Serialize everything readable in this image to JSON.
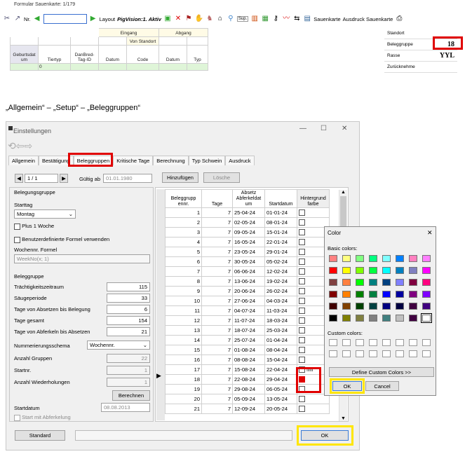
{
  "toolbar": {
    "title": "Formular Sauenkarte: 1/179",
    "nr_label": "Nr.",
    "layout_label": "Layout",
    "view_label": "PigVision:1. Aktiv",
    "sup_label": "Sup.",
    "sauenkarte_label": "Sauenkarte",
    "ausdruck_label": "Ausdruck Sauenkarte"
  },
  "top_grid": {
    "eingang": "Eingang",
    "von_standort": "Von Standort",
    "abgang": "Abgang",
    "headers": [
      "Geburtsdat um",
      "Tiertyp",
      "DanBred-Tag-ID",
      "Datum",
      "Code",
      "Datum",
      "Typ"
    ],
    "first_value": "0"
  },
  "right_panel": {
    "rows": [
      {
        "label": "Standort",
        "value": ""
      },
      {
        "label": "Beleggruppe",
        "value": "18"
      },
      {
        "label": "Rasse",
        "value": "YYL"
      },
      {
        "label": "Zurücknehme",
        "value": ""
      }
    ]
  },
  "caption": "„Allgemein“ – „Setup“ – „Beleggruppen“",
  "window": {
    "title": "Einstellungen",
    "tabs": [
      "Allgemein",
      "Bestätigung",
      "Beleggruppen",
      "Kritische Tage",
      "Berechnung",
      "Typ Schwein",
      "Ausdruck"
    ],
    "active_tab": 2,
    "pager": "1 / 1",
    "gueltig_label": "Gültig ab",
    "gueltig_value": "01.01.1980",
    "hinzufuegen": "Hinzufügen",
    "loesche": "Lösche",
    "belegungsgruppe_title": "Belegungsgruppe",
    "starttag_label": "Starttag",
    "starttag_value": "Montag",
    "plus1woche": "Plus 1 Woche",
    "formel_check": "Benutzerdefinierte Formel verwenden",
    "wochennr_label": "Wochennr. Formel",
    "wochennr_value": "WeekNo(x; 1)",
    "beleggruppe_title": "Beleggruppe",
    "fields": [
      {
        "label": "Trächtigkeitszeitraum",
        "value": "115"
      },
      {
        "label": "Säugeperiode",
        "value": "33"
      },
      {
        "label": "Tage von Absetzen bis Belegung",
        "value": "6"
      },
      {
        "label": "Tage gesamt",
        "value": "154"
      },
      {
        "label": "Tage von Abferkeln bis Absetzen",
        "value": "21"
      }
    ],
    "nummerierung_label": "Nummerierungsschema",
    "nummerierung_value": "Wochennr.",
    "gray_fields": [
      {
        "label": "Anzahl Gruppen",
        "value": "22"
      },
      {
        "label": "Startnr.",
        "value": "1"
      },
      {
        "label": "Anzahl Wiederholungen",
        "value": "1"
      }
    ],
    "berechnen": "Berechnen",
    "startdatum_label": "Startdatum",
    "startdatum_value": "08.08.2013",
    "start_abferkelung": "Start mit Abferkelung",
    "standard": "Standard",
    "ok": "OK"
  },
  "table": {
    "headers": [
      "Beleggrupp ennr.",
      "Tage",
      "Abferkeldat um",
      "Startdatum",
      "Hintergrund farbe"
    ],
    "header_top_fragment": "Absetz",
    "rows": [
      [
        "1",
        "7",
        "25-04-24",
        "01-01-24"
      ],
      [
        "2",
        "7",
        "02-05-24",
        "08-01-24"
      ],
      [
        "3",
        "7",
        "09-05-24",
        "15-01-24"
      ],
      [
        "4",
        "7",
        "16-05-24",
        "22-01-24"
      ],
      [
        "5",
        "7",
        "23-05-24",
        "29-01-24"
      ],
      [
        "6",
        "7",
        "30-05-24",
        "05-02-24"
      ],
      [
        "7",
        "7",
        "06-06-24",
        "12-02-24"
      ],
      [
        "8",
        "7",
        "13-06-24",
        "19-02-24"
      ],
      [
        "9",
        "7",
        "20-06-24",
        "26-02-24"
      ],
      [
        "10",
        "7",
        "27-06-24",
        "04-03-24"
      ],
      [
        "11",
        "7",
        "04-07-24",
        "11-03-24"
      ],
      [
        "12",
        "7",
        "11-07-24",
        "18-03-24"
      ],
      [
        "13",
        "7",
        "18-07-24",
        "25-03-24"
      ],
      [
        "14",
        "7",
        "25-07-24",
        "01-04-24"
      ],
      [
        "15",
        "7",
        "01-08-24",
        "08-04-24"
      ],
      [
        "16",
        "7",
        "08-08-24",
        "15-04-24"
      ],
      [
        "17",
        "7",
        "15-08-24",
        "22-04-24"
      ],
      [
        "18",
        "7",
        "22-08-24",
        "29-04-24"
      ],
      [
        "19",
        "7",
        "29-08-24",
        "06-05-24"
      ],
      [
        "20",
        "7",
        "05-09-24",
        "13-05-24"
      ],
      [
        "21",
        "7",
        "12-09-24",
        "20-05-24"
      ]
    ],
    "color_text_row17": "ffffff",
    "row18_color": "#e00000"
  },
  "color_dialog": {
    "title": "Color",
    "basic_label": "Basic colors:",
    "custom_label": "Custom colors:",
    "define": "Define Custom Colors >>",
    "ok": "OK",
    "cancel": "Cancel",
    "basic_colors": [
      "#ff8080",
      "#ffff80",
      "#80ff80",
      "#00ff80",
      "#80ffff",
      "#0080ff",
      "#ff80c0",
      "#ff80ff",
      "#ff0000",
      "#ffff00",
      "#80ff00",
      "#00ff40",
      "#00ffff",
      "#0080c0",
      "#8080c0",
      "#ff00ff",
      "#804040",
      "#ff8040",
      "#00ff00",
      "#008080",
      "#004080",
      "#8080ff",
      "#800040",
      "#ff0080",
      "#800000",
      "#ff8000",
      "#008000",
      "#008040",
      "#0000ff",
      "#0000a0",
      "#800080",
      "#8000ff",
      "#400000",
      "#804000",
      "#004000",
      "#004040",
      "#000080",
      "#000040",
      "#400040",
      "#400080",
      "#000000",
      "#808000",
      "#808040",
      "#808080",
      "#408080",
      "#c0c0c0",
      "#400040",
      "#ffffff"
    ]
  }
}
